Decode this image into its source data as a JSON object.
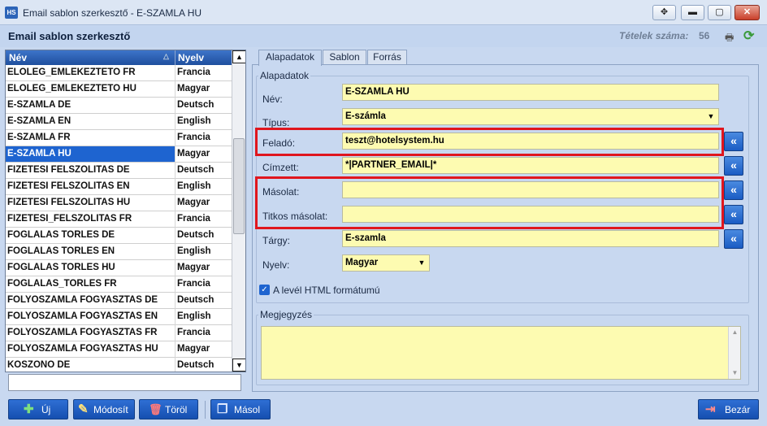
{
  "window": {
    "title": "Email sablon szerkesztő - E-SZAMLA HU",
    "icon": "HS",
    "buttons": [
      "move-icon",
      "minimize-icon",
      "maximize-icon",
      "close-icon"
    ],
    "move_glyph": "✥",
    "min_glyph": "▬",
    "max_glyph": "▢",
    "close_glyph": "✕"
  },
  "header": {
    "title": "Email sablon szerkesztő",
    "count_label": "Tételek száma:",
    "count_value": "56",
    "print_glyph": "🖶",
    "refresh_glyph": "⟳"
  },
  "list": {
    "columns": {
      "name": "Név",
      "language": "Nyelv"
    },
    "sort_glyph": "△",
    "rows": [
      {
        "name": "ELOLEG_EMLEKEZTETO FR",
        "language": "Francia"
      },
      {
        "name": "ELOLEG_EMLEKEZTETO HU",
        "language": "Magyar"
      },
      {
        "name": "E-SZAMLA DE",
        "language": "Deutsch"
      },
      {
        "name": "E-SZAMLA EN",
        "language": "English"
      },
      {
        "name": "E-SZAMLA FR",
        "language": "Francia"
      },
      {
        "name": "E-SZAMLA HU",
        "language": "Magyar",
        "selected": true
      },
      {
        "name": "FIZETESI FELSZOLITAS DE",
        "language": "Deutsch"
      },
      {
        "name": "FIZETESI FELSZOLITAS EN",
        "language": "English"
      },
      {
        "name": "FIZETESI FELSZOLITAS HU",
        "language": "Magyar"
      },
      {
        "name": "FIZETESI_FELSZOLITAS FR",
        "language": "Francia"
      },
      {
        "name": "FOGLALAS TORLES DE",
        "language": "Deutsch"
      },
      {
        "name": "FOGLALAS TORLES EN",
        "language": "English"
      },
      {
        "name": "FOGLALAS TORLES HU",
        "language": "Magyar"
      },
      {
        "name": "FOGLALAS_TORLES FR",
        "language": "Francia"
      },
      {
        "name": "FOLYOSZAMLA FOGYASZTAS DE",
        "language": "Deutsch"
      },
      {
        "name": "FOLYOSZAMLA FOGYASZTAS EN",
        "language": "English"
      },
      {
        "name": "FOLYOSZAMLA FOGYASZTAS FR",
        "language": "Francia"
      },
      {
        "name": "FOLYOSZAMLA FOGYASZTAS HU",
        "language": "Magyar"
      },
      {
        "name": "KOSZONO DE",
        "language": "Deutsch"
      }
    ],
    "scroll_up_glyph": "▲",
    "scroll_down_glyph": "▼",
    "filter_value": ""
  },
  "tabs": [
    {
      "label": "Alapadatok",
      "active": true
    },
    {
      "label": "Sablon",
      "active": false
    },
    {
      "label": "Forrás",
      "active": false
    }
  ],
  "form": {
    "group_title": "Alapadatok",
    "name_label": "Név:",
    "name_value": "E-SZAMLA HU",
    "type_label": "Típus:",
    "type_value": "E-számla",
    "sender_label": "Feladó:",
    "sender_value": "teszt@hotelsystem.hu",
    "recipient_label": "Címzett:",
    "recipient_value": "*|PARTNER_EMAIL|*",
    "cc_label": "Másolat:",
    "cc_value": "",
    "bcc_label": "Titkos másolat:",
    "bcc_value": "",
    "subject_label": "Tárgy:",
    "subject_value": "E-szamla",
    "language_label": "Nyelv:",
    "language_value": "Magyar",
    "dropdown_glyph": "▼",
    "insert_glyph": "«",
    "html_checked": true,
    "check_glyph": "✓",
    "html_label": "A levél HTML formátumú",
    "notes_title": "Megjegyzés",
    "notes_value": ""
  },
  "toolbar": {
    "new_label": "Új",
    "edit_label": "Módosít",
    "delete_label": "Töröl",
    "copy_label": "Másol",
    "close_label": "Bezár",
    "new_glyph": "✚",
    "edit_glyph": "✎",
    "delete_glyph": "🗑",
    "copy_glyph": "❐",
    "close_glyph": "⇥"
  },
  "colors": {
    "accent": "#1e64d0",
    "field_bg": "#fdfbb1",
    "highlight_border": "#e0161e",
    "panel_bg": "#c8d8f0"
  }
}
